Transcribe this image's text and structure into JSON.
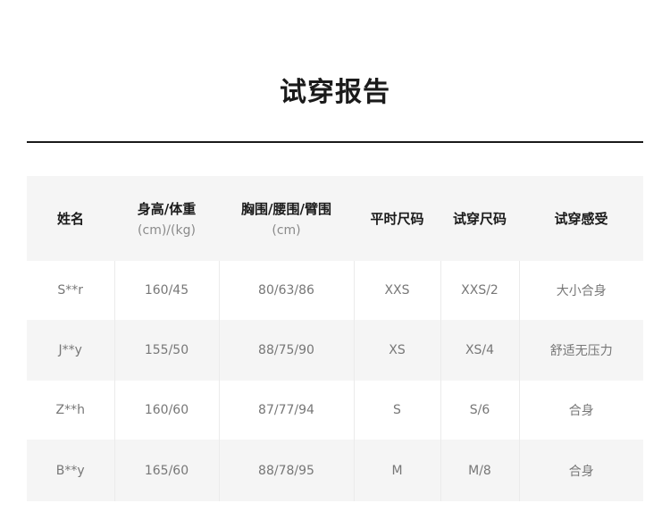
{
  "title": "试穿报告",
  "table": {
    "headers": [
      {
        "label": "姓名",
        "sub": ""
      },
      {
        "label": "身高/体重",
        "sub": "(cm)/(kg)"
      },
      {
        "label": "胸围/腰围/臂围",
        "sub": "(cm)"
      },
      {
        "label": "平时尺码",
        "sub": ""
      },
      {
        "label": "试穿尺码",
        "sub": ""
      },
      {
        "label": "试穿感受",
        "sub": ""
      }
    ],
    "rows": [
      [
        "S**r",
        "160/45",
        "80/63/86",
        "XXS",
        "XXS/2",
        "大小合身"
      ],
      [
        "J**y",
        "155/50",
        "88/75/90",
        "XS",
        "XS/4",
        "舒适无压力"
      ],
      [
        "Z**h",
        "160/60",
        "87/77/94",
        "S",
        "S/6",
        "合身"
      ],
      [
        "B**y",
        "165/60",
        "88/78/95",
        "M",
        "M/8",
        "合身"
      ]
    ]
  }
}
